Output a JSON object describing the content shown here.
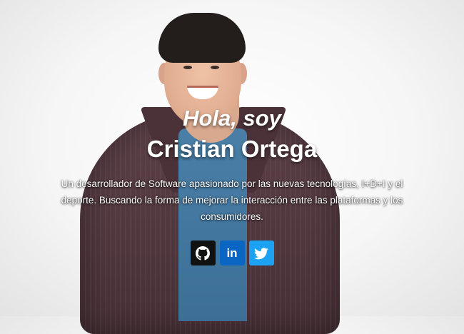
{
  "hero": {
    "greeting": "Hola, soy",
    "name": "Cristian Ortega",
    "description": "Un desarrollador de Software apasionado por las nuevas tecnologías, I+D+I y el deporte. Buscando la forma de mejorar la interacción entre las plataformas y los consumidores."
  },
  "social": [
    {
      "icon": "github-icon",
      "color": "#111111"
    },
    {
      "icon": "linkedin-icon",
      "label": "in",
      "color": "#0A66C2"
    },
    {
      "icon": "twitter-icon",
      "color": "#1DA1F2"
    }
  ],
  "colors": {
    "background": "#F6F6F6",
    "text": "#FFFFFF",
    "shirt": "#5B4047",
    "tshirt": "#4A7FA8"
  }
}
